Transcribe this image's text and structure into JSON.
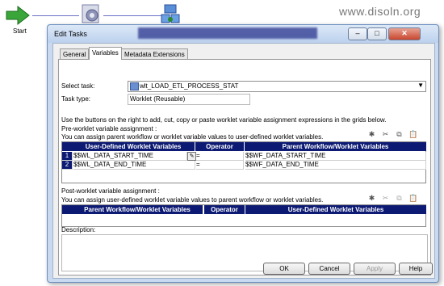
{
  "watermark": "www.disoln.org",
  "canvas": {
    "start_label": "Start"
  },
  "dialog": {
    "title": "Edit Tasks",
    "tabs": [
      "General",
      "Variables",
      "Metadata Extensions"
    ],
    "select_task_label": "Select task:",
    "select_task_value": "wlt_LOAD_ETL_PROCESS_STAT",
    "task_type_label": "Task type:",
    "task_type_value": "Worklet (Reusable)",
    "instructions": "Use the buttons on the right to add, cut, copy or paste worklet variable assignment expressions in the grids below.",
    "pre": {
      "heading": "Pre-worklet variable assignment :",
      "note": "You can assign parent workflow or worklet variable values to user-defined worklet variables.",
      "columns": [
        "User-Defined Worklet Variables",
        "Operator",
        "Parent Workflow/Worklet Variables"
      ],
      "rows": [
        {
          "num": "1",
          "left": "$$WL_DATA_START_TIME",
          "op": "=",
          "right": "$$WF_DATA_START_TIME"
        },
        {
          "num": "2",
          "left": "$$WL_DATA_END_TIME",
          "op": "=",
          "right": "$$WF_DATA_END_TIME"
        }
      ]
    },
    "post": {
      "heading": "Post-worklet variable assignment :",
      "note": "You can assign user-defined worklet variable values to parent workflow or worklet variables.",
      "columns": [
        "Parent Workflow/Worklet Variables",
        "Operator",
        "User-Defined Worklet Variables"
      ]
    },
    "description_label": "Description:",
    "buttons": {
      "ok": "OK",
      "cancel": "Cancel",
      "apply": "Apply",
      "help": "Help"
    },
    "win_buttons": {
      "minimize": "–",
      "maximize": "□",
      "close": "✕"
    }
  }
}
